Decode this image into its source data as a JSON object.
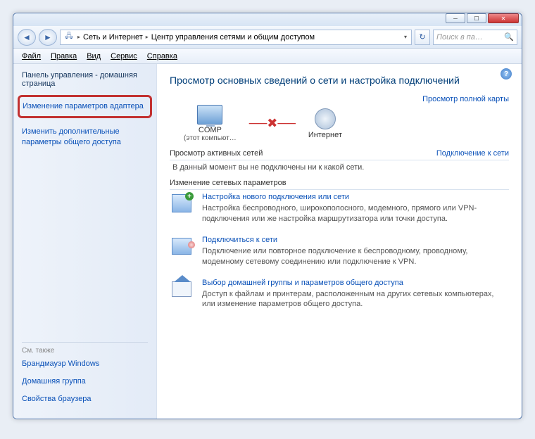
{
  "titlebar": {
    "minimize": "─",
    "maximize": "☐",
    "close": "✕"
  },
  "nav": {
    "back": "◄",
    "forward": "►",
    "refresh": "↻",
    "dropdown": "▾"
  },
  "breadcrumb": {
    "root": "Сеть и Интернет",
    "current": "Центр управления сетями и общим доступом"
  },
  "search": {
    "placeholder": "Поиск в па…"
  },
  "menu": {
    "file": "Файл",
    "edit": "Правка",
    "view": "Вид",
    "tools": "Сервис",
    "help": "Справка"
  },
  "sidebar": {
    "home": "Панель управления - домашняя страница",
    "link_adapter": "Изменение параметров адаптера",
    "link_advanced": "Изменить дополнительные параметры общего доступа",
    "seealso": "См. также",
    "link_firewall": "Брандмауэр Windows",
    "link_homegroup": "Домашняя группа",
    "link_browser": "Свойства браузера"
  },
  "content": {
    "heading": "Просмотр основных сведений о сети и настройка подключений",
    "view_full_map": "Просмотр полной карты",
    "node_this_name": "COMP",
    "node_this_sub": "(этот компьют…",
    "node_internet": "Интернет",
    "section_active": "Просмотр активных сетей",
    "connect_link": "Подключение к сети",
    "active_text": "В данный момент вы не подключены ни к какой сети.",
    "section_change": "Изменение сетевых параметров",
    "item1_title": "Настройка нового подключения или сети",
    "item1_desc": "Настройка беспроводного, широкополосного, модемного, прямого или VPN-подключения или же настройка маршрутизатора или точки доступа.",
    "item2_title": "Подключиться к сети",
    "item2_desc": "Подключение или повторное подключение к беспроводному, проводному, модемному сетевому соединению или подключение к VPN.",
    "item3_title": "Выбор домашней группы и параметров общего доступа",
    "item3_desc": "Доступ к файлам и принтерам, расположенным на других сетевых компьютерах, или изменение параметров общего доступа."
  }
}
